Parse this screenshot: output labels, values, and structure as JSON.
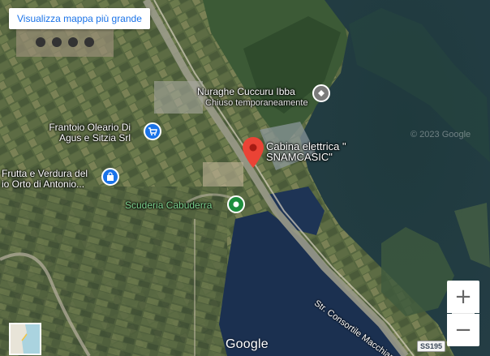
{
  "map": {
    "larger_map_link": "Visualizza mappa più grande",
    "google_logo": "Google",
    "copyright": "© 2023 Google",
    "zoom_in": "+",
    "zoom_out": "−"
  },
  "pois": {
    "nuraghe": {
      "line1": "Nuraghe Cuccuru Ibba",
      "line2": "Chiuso temporaneamente"
    },
    "cabina": {
      "line1": "Cabina elettrica \"",
      "line2": "SNAMCASIC\""
    },
    "frantoio": {
      "line1": "Frantoio Oleario Di",
      "line2": "Agus e Sitzia Srl"
    },
    "frutta": {
      "line1": "Frutta e Verdura del",
      "line2": "io Orto di Antonio..."
    },
    "scuderia": {
      "line1": "Scuderia Cabuderra"
    }
  },
  "roads": {
    "consortile": "Str. Consortile Macchiared...",
    "ss195": "SS195"
  },
  "colors": {
    "pin_red": "#ea4335",
    "shop_blue": "#1a73e8",
    "green_poi": "#1e8e3e",
    "museum_gray": "#7b7b7b"
  }
}
